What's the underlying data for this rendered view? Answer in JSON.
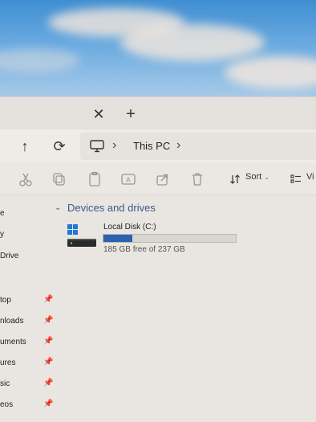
{
  "tabbar": {
    "close_glyph": "✕",
    "new_tab_glyph": "+"
  },
  "nav": {
    "up_glyph": "↑",
    "refresh_glyph": "⟳",
    "location_icon": "pc-icon",
    "chevron": "›",
    "breadcrumb": "This PC"
  },
  "toolbar": {
    "icons": [
      "cut-icon",
      "copy-icon",
      "paste-icon",
      "rename-icon",
      "share-icon",
      "delete-icon"
    ],
    "sort_label": "Sort",
    "view_label": "Vi"
  },
  "sidebar": {
    "items": [
      {
        "label": "e",
        "pinned": false
      },
      {
        "label": "y",
        "pinned": false
      },
      {
        "label": "Drive",
        "pinned": false
      },
      {
        "label": "top",
        "pinned": true
      },
      {
        "label": "nloads",
        "pinned": true
      },
      {
        "label": "uments",
        "pinned": true
      },
      {
        "label": "ures",
        "pinned": true
      },
      {
        "label": "sic",
        "pinned": true
      },
      {
        "label": "eos",
        "pinned": true
      }
    ]
  },
  "content": {
    "group_label": "Devices and drives",
    "drive": {
      "name": "Local Disk (C:)",
      "free_text": "185 GB free of 237 GB",
      "used_fraction": 0.22
    }
  },
  "colors": {
    "accent": "#2b62b0",
    "group_header": "#3b5a8c"
  }
}
